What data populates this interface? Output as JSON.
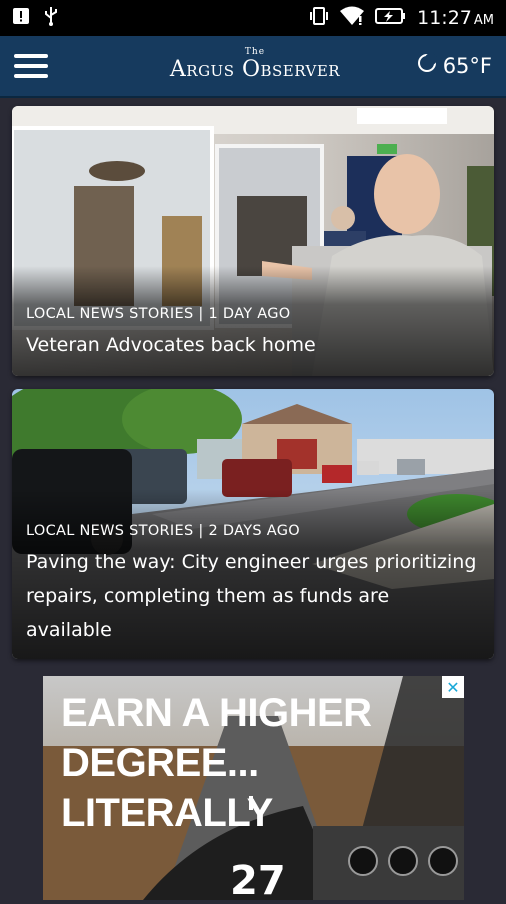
{
  "status_bar": {
    "time": "11:27",
    "ampm": "AM",
    "icons": [
      "alert-icon",
      "usb-icon",
      "vibrate-icon",
      "wifi-icon",
      "battery-charging-icon"
    ]
  },
  "app_bar": {
    "logo_small": "The",
    "logo_text": "Argus Observer",
    "temperature": "65°F",
    "weather_icon": "moon-icon"
  },
  "stories": [
    {
      "category_time": "LOCAL NEWS STORIES | 1 DAY AGO",
      "headline": "Veteran Advocates back home"
    },
    {
      "category_time": "LOCAL NEWS STORIES | 2 DAYS AGO",
      "headline": "Paving the way: City engineer urges prioritizing repairs, completing them as funds are available"
    }
  ],
  "ad": {
    "lines": [
      "EARN A HIGHER",
      "DEGREE...",
      "LITERALLY"
    ],
    "runway_number": "27",
    "close_icon": "close-icon"
  },
  "colors": {
    "app_bar": "#163a5e",
    "background": "#2a2a35",
    "status_bar": "#000000",
    "ad_close": "#19a8d8"
  }
}
